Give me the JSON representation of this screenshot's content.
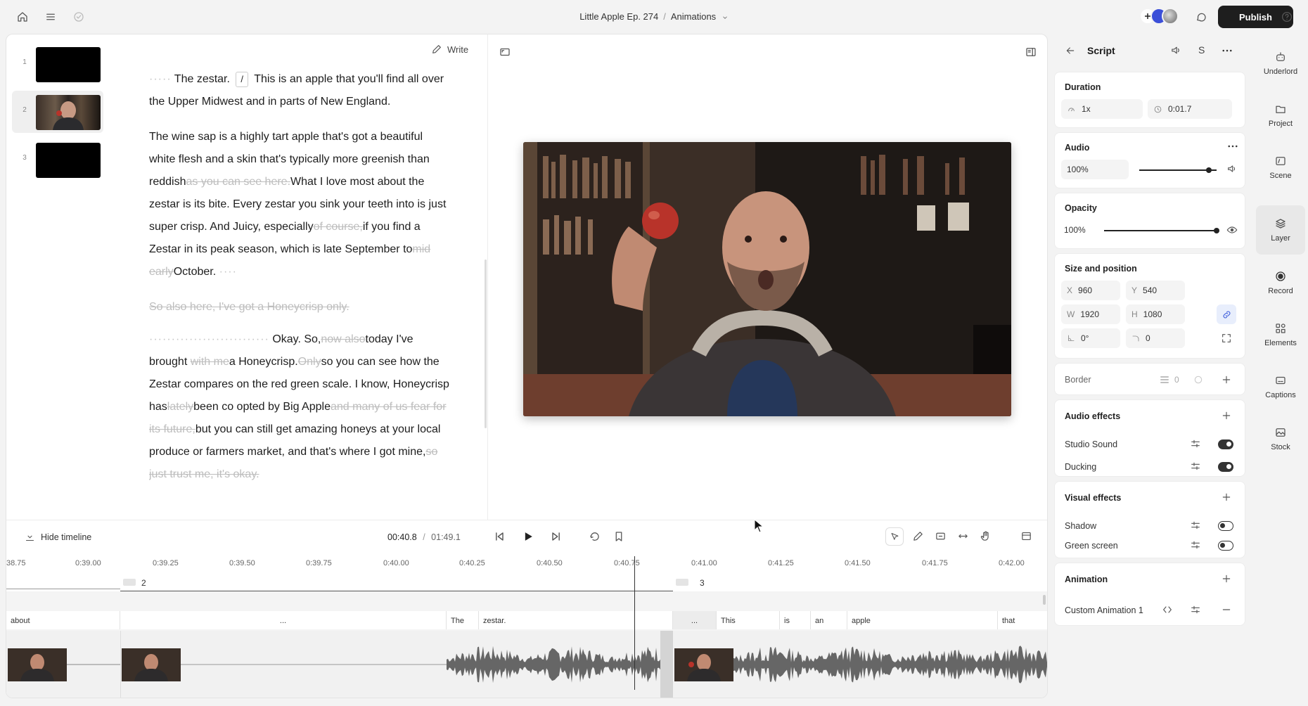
{
  "topbar": {
    "project": "Little Apple Ep. 274",
    "separator": "/",
    "composition": "Animations",
    "publish": "Publish"
  },
  "thumbnails": [
    {
      "num": "1"
    },
    {
      "num": "2"
    },
    {
      "num": "3"
    }
  ],
  "editor": {
    "write_label": "Write",
    "script": {
      "p1_a": "The zestar.",
      "p1_b": "/",
      "p1_c": "This is an apple that you'll find all over the Upper Midwest and in parts of New England.",
      "p2_a": "The wine sap is a highly tart apple that's got a beautiful white flesh and a skin that's typically more greenish than reddish",
      "p2_del1": "as you can see here.",
      "p2_b": "What I love most about the zestar is its bite. Every zestar you sink your teeth into is just super crisp. And Juicy, especially",
      "p2_del2": "of course,",
      "p2_c": "if you find a Zestar in its peak season, which is late September to",
      "p2_del3": "mid early",
      "p2_d": "October.",
      "p3_del": "So also here, I've got a Honeycrisp only.",
      "p4_a": "Okay. So,",
      "p4_del1": "now also",
      "p4_b": "today I've brought",
      "p4_del2": "with me",
      "p4_c": "a Honeycrisp.",
      "p4_del3": "Only",
      "p4_d": "so you can see how the Zestar compares on the red green scale.",
      "p4_e": "I know, Honeycrisp has",
      "p4_del4": "lately",
      "p4_f": "been co opted by Big Apple",
      "p4_del5": "and many of us fear for its future,",
      "p4_g": "but you can still get amazing honeys at your local produce or farmers market, and that's where I got mine,",
      "p4_del6": "so just trust me, it's okay."
    }
  },
  "timeline": {
    "hide_label": "Hide timeline",
    "current_time": "00:40.8",
    "time_sep": "/",
    "total_time": "01:49.1",
    "ruler": [
      "38.75",
      "0:39.00",
      "0:39.25",
      "0:39.50",
      "0:39.75",
      "0:40.00",
      "0:40.25",
      "0:40.50",
      "0:40.75",
      "0:41.00",
      "0:41.25",
      "0:41.50",
      "0:41.75",
      "0:42.00"
    ],
    "scene_2": "2",
    "scene_3": "3",
    "words": [
      "about",
      "...",
      "The",
      "zestar.",
      "...",
      "This",
      "is",
      "an",
      "apple",
      "that"
    ]
  },
  "panel": {
    "title": "Script",
    "s_label": "S",
    "duration": {
      "title": "Duration",
      "speed": "1x",
      "time": "0:01.7"
    },
    "audio": {
      "title": "Audio",
      "volume": "100%",
      "level": 0.9
    },
    "opacity": {
      "title": "Opacity",
      "value": "100%",
      "level": 1.0
    },
    "size_position": {
      "title": "Size and position",
      "x_label": "X",
      "x": "960",
      "y_label": "Y",
      "y": "540",
      "w_label": "W",
      "w": "1920",
      "h_label": "H",
      "h": "1080",
      "rotation": "0°",
      "corner": "0"
    },
    "border": {
      "title": "Border",
      "value": "0"
    },
    "audio_effects": {
      "title": "Audio effects",
      "studio_sound": "Studio Sound",
      "ducking": "Ducking"
    },
    "visual_effects": {
      "title": "Visual effects",
      "shadow": "Shadow",
      "green_screen": "Green screen"
    },
    "animation": {
      "title": "Animation",
      "item": "Custom Animation 1"
    }
  },
  "rail": {
    "underlord": "Underlord",
    "project": "Project",
    "scene": "Scene",
    "layer": "Layer",
    "record": "Record",
    "elements": "Elements",
    "captions": "Captions",
    "stock": "Stock"
  }
}
